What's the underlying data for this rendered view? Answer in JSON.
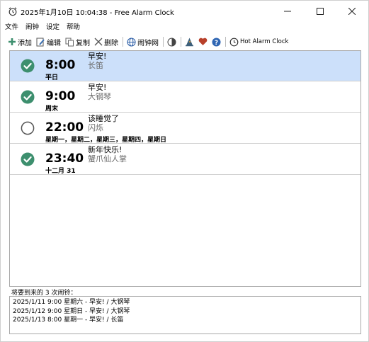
{
  "window": {
    "title": "2025年1月10日 10:04:38 - Free Alarm Clock",
    "icon": "alarm-clock-icon",
    "minimize": "—",
    "maximize": "☐",
    "close": "✕"
  },
  "menu": [
    "文件",
    "闹钟",
    "设定",
    "帮助"
  ],
  "toolbar": {
    "add": "添加",
    "edit": "编辑",
    "copy": "复制",
    "delete": "删除",
    "website": "闹钟网",
    "hot": "Hot Alarm Clock"
  },
  "alarms": [
    {
      "enabled": true,
      "time": "8:00",
      "days": "平日",
      "message": "早安!",
      "sound": "长笛",
      "selected": true
    },
    {
      "enabled": true,
      "time": "9:00",
      "days": "周末",
      "message": "早安!",
      "sound": "大钢琴",
      "selected": false
    },
    {
      "enabled": false,
      "time": "22:00",
      "days": "星期一，星期二，星期三，星期四，星期日",
      "message": "该睡觉了",
      "sound": "闪烁",
      "selected": false
    },
    {
      "enabled": true,
      "time": "23:40",
      "days": "十二月 31",
      "message": "新年快乐!",
      "sound": "蟹爪仙人掌",
      "selected": false
    }
  ],
  "upcoming": {
    "label": "将要到来的 3 次闹铃：",
    "items": [
      "2025/1/11 9:00 星期六 - 早安! / 大钢琴",
      "2025/1/12 9:00 星期日 - 早安! / 大钢琴",
      "2025/1/13 8:00 星期一 - 早安! / 长笛"
    ]
  },
  "colors": {
    "accent": "#3d8f6e",
    "selected_row": "#cce0fa",
    "sound_text": "#6a6a6a"
  }
}
